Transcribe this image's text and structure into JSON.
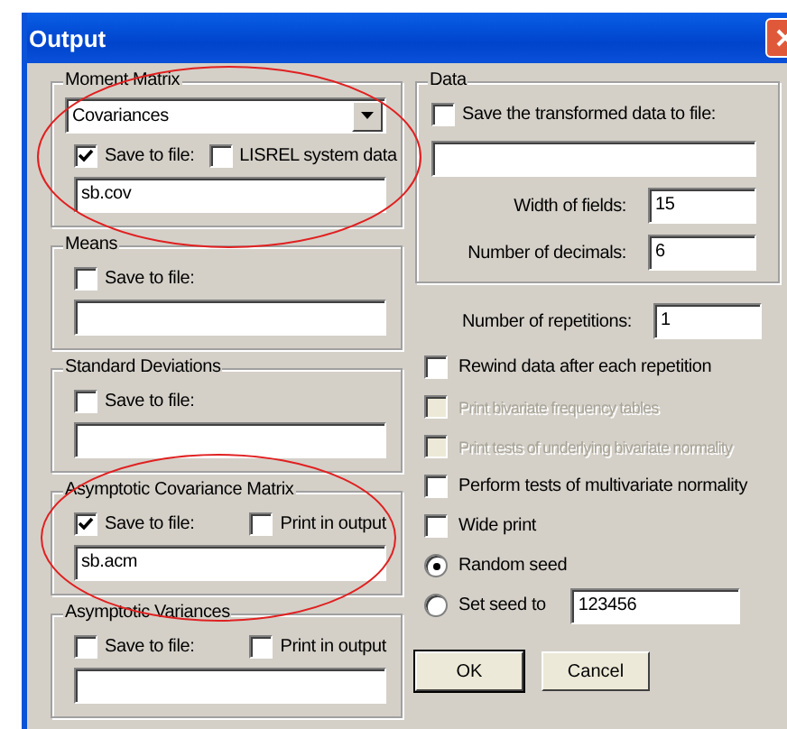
{
  "window": {
    "title": "Output"
  },
  "moment_matrix": {
    "title": "Moment Matrix",
    "dropdown": {
      "value": "Covariances"
    },
    "save_to_file": {
      "label": "Save to file:",
      "checked": true
    },
    "system_data": {
      "label": "LISREL system data",
      "checked": false
    },
    "file": {
      "value": "sb.cov"
    }
  },
  "output_groups": [
    {
      "title": "Means",
      "save_to_file": {
        "label": "Save to file:",
        "checked": false
      }
    },
    {
      "title": "Standard Deviations",
      "save_to_file": {
        "label": "Save to file:",
        "checked": false
      }
    },
    {
      "title": "Asymptotic Covariance Matrix",
      "save_to_file": {
        "label": "Save to file:",
        "checked": true
      },
      "print_in_output": {
        "label": "Print in output",
        "checked": false
      },
      "file": {
        "value": "sb.acm"
      }
    },
    {
      "title": "Asymptotic Variances",
      "save_to_file": {
        "label": "Save to file:",
        "checked": false
      },
      "print_in_output": {
        "label": "Print in output",
        "checked": false
      }
    }
  ],
  "data": {
    "title": "Data",
    "save_transformed": {
      "label": "Save the transformed data to file:",
      "checked": false
    },
    "width_of_fields": {
      "label": "Width of fields:",
      "value": "15"
    },
    "number_of_decimals": {
      "label": "Number of decimals:",
      "value": "6"
    }
  },
  "repetitions": {
    "label": "Number of repetitions:",
    "value": "1"
  },
  "options": [
    {
      "kind": "checkbox",
      "label": "Rewind data after each repetition",
      "checked": false,
      "disabled": false
    },
    {
      "kind": "checkbox",
      "label": "Print bivariate frequency tables",
      "checked": false,
      "disabled": true
    },
    {
      "kind": "checkbox",
      "label": "Print tests of underlying bivariate normality",
      "checked": false,
      "disabled": true
    },
    {
      "kind": "checkbox",
      "label": "Perform tests of multivariate normality",
      "checked": false,
      "disabled": false
    },
    {
      "kind": "checkbox",
      "label": "Wide print",
      "checked": false,
      "disabled": false
    },
    {
      "kind": "radio",
      "label": "Random seed",
      "selected": true
    },
    {
      "kind": "radio",
      "label": "Set seed to",
      "selected": false,
      "value": "123456"
    }
  ],
  "buttons": [
    {
      "label": "OK",
      "default": true
    },
    {
      "label": "Cancel",
      "default": false
    }
  ]
}
